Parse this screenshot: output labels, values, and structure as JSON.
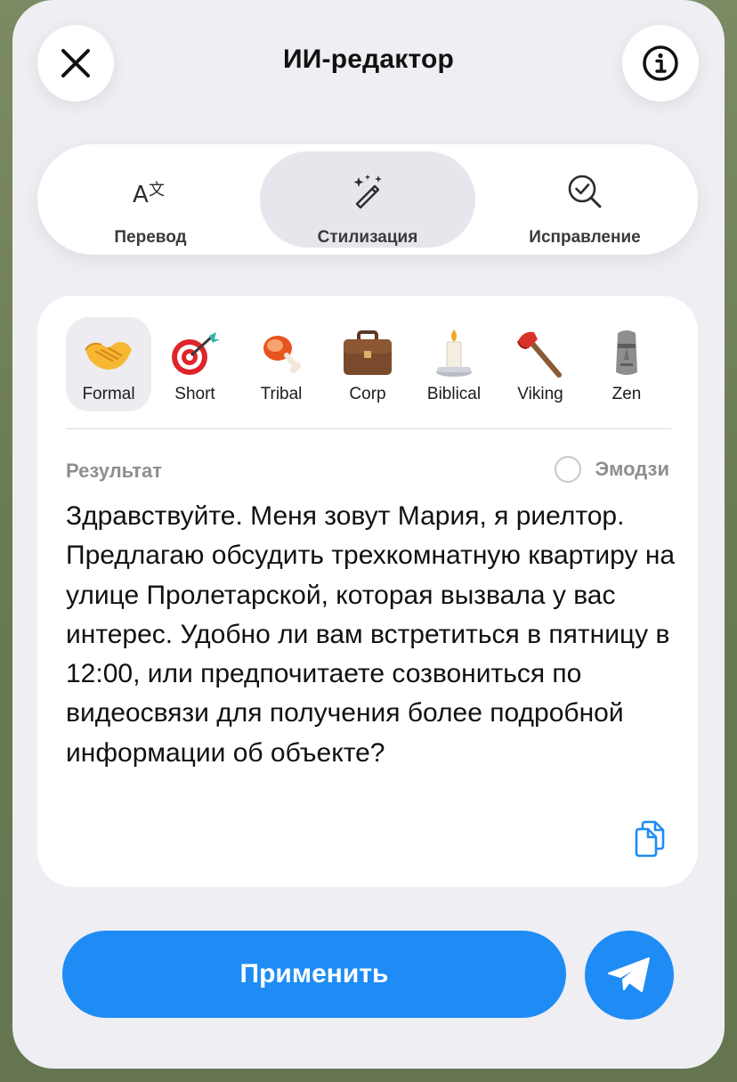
{
  "header": {
    "title": "ИИ-редактор",
    "close_icon": "close-icon",
    "info_icon": "info-icon"
  },
  "modes": [
    {
      "label": "Перевод",
      "icon": "translate-icon",
      "active": false
    },
    {
      "label": "Стилизация",
      "icon": "magic-wand-icon",
      "active": true
    },
    {
      "label": "Исправление",
      "icon": "check-search-icon",
      "active": false
    }
  ],
  "styles": [
    {
      "label": "Formal",
      "icon": "handshake-emoji",
      "active": true
    },
    {
      "label": "Short",
      "icon": "dart-emoji",
      "active": false
    },
    {
      "label": "Tribal",
      "icon": "meat-emoji",
      "active": false
    },
    {
      "label": "Corp",
      "icon": "briefcase-emoji",
      "active": false
    },
    {
      "label": "Biblical",
      "icon": "candle-emoji",
      "active": false
    },
    {
      "label": "Viking",
      "icon": "axe-emoji",
      "active": false
    },
    {
      "label": "Zen",
      "icon": "moai-emoji",
      "active": false
    }
  ],
  "result": {
    "label": "Результат",
    "emoji_toggle_label": "Эмодзи",
    "emoji_enabled": false,
    "text": "Здравствуйте. Меня зовут Мария, я риелтор. Предлагаю обсудить трехкомнатную квартиру на улице Пролетарской, которая вызвала у вас интерес. Удобно ли вам встретиться в пятницу в 12:00, или предпочитаете созвониться по видеосвязи для получения более подробной информации об объекте?",
    "copy_icon": "copy-icon"
  },
  "footer": {
    "apply_label": "Применить",
    "send_icon": "send-icon"
  },
  "colors": {
    "accent": "#1f8cf5",
    "sheet_bg": "#eeeef3"
  }
}
